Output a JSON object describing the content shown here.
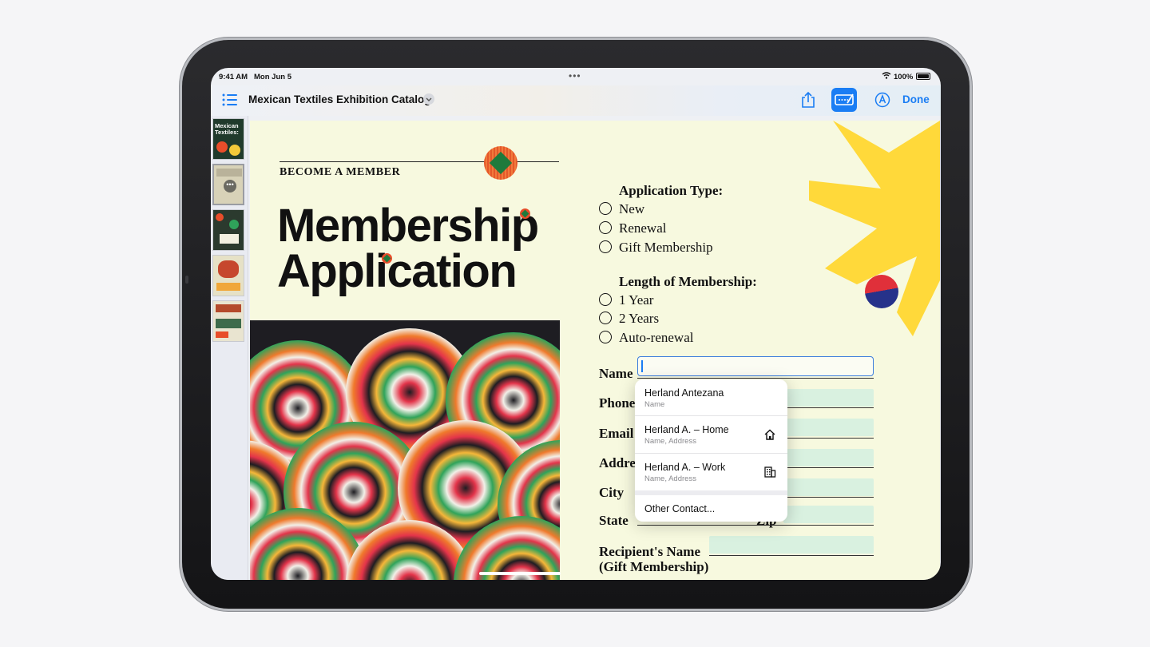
{
  "status_bar": {
    "time": "9:41 AM",
    "date": "Mon Jun 5",
    "battery": "100%"
  },
  "toolbar": {
    "document_title": "Mexican Textiles Exhibition Catalog",
    "done_label": "Done"
  },
  "thumbnails": {
    "cover_text": "Mexican Textiles:"
  },
  "page": {
    "kicker": "BECOME A MEMBER",
    "title_line1": "Membership",
    "title_line2": "Application"
  },
  "form": {
    "application_type": {
      "heading": "Application Type:",
      "options": [
        "New",
        "Renewal",
        "Gift Membership"
      ]
    },
    "length": {
      "heading": "Length of Membership:",
      "options": [
        "1 Year",
        "2 Years",
        "Auto-renewal"
      ]
    },
    "fields": [
      "Name",
      "Phone",
      "Email",
      "Address",
      "City",
      "State",
      "Zip"
    ],
    "recipient_line1": "Recipient's Name",
    "recipient_line2": "(Gift Membership)"
  },
  "autofill": {
    "items": [
      {
        "title": "Herland Antezana",
        "subtitle": "Name",
        "icon": "none"
      },
      {
        "title": "Herland A. – Home",
        "subtitle": "Name, Address",
        "icon": "house-icon"
      },
      {
        "title": "Herland A. – Work",
        "subtitle": "Name, Address",
        "icon": "building-icon"
      }
    ],
    "other_contact": "Other Contact..."
  },
  "colors": {
    "accent": "#1a7df4",
    "page": "#f7f9df",
    "field": "#d9f1e0",
    "sun": "#ffd93a"
  }
}
